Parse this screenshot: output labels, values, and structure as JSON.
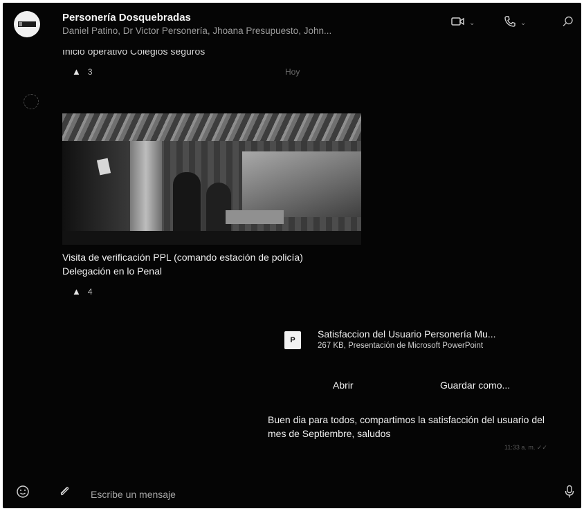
{
  "header": {
    "title": "Personería Dosquebradas",
    "members": "Daniel Patino, Dr Victor Personería, Jhoana Presupuesto, John..."
  },
  "messages": {
    "first": {
      "text": "Inicio operativo Colegios seguros",
      "reaction_count": "3",
      "time": "Hoy"
    },
    "photo_post": {
      "caption": "Visita de verificación PPL (comando estación de policía) Delegación en lo Penal",
      "reaction_count": "4"
    },
    "file": {
      "icon_label": "P",
      "name": "Satisfaccion del Usuario Personería Mu...",
      "meta": "267 KB, Presentación de Microsoft PowerPoint",
      "open_label": "Abrir",
      "save_as_label": "Guardar como..."
    },
    "last": {
      "text": "Buen dia para todos, compartimos la satisfacción del usuario del mes de Septiembre, saludos",
      "time": "11:33 a. m. ✓✓"
    }
  },
  "input": {
    "placeholder": "Escribe un mensaje"
  },
  "icons": {
    "video": "video-call-icon",
    "phone": "phone-call-icon",
    "search": "search-icon",
    "emoji": "emoji-icon",
    "attach": "paperclip-icon",
    "mic": "microphone-icon",
    "thumb": "thumbs-up-icon"
  }
}
